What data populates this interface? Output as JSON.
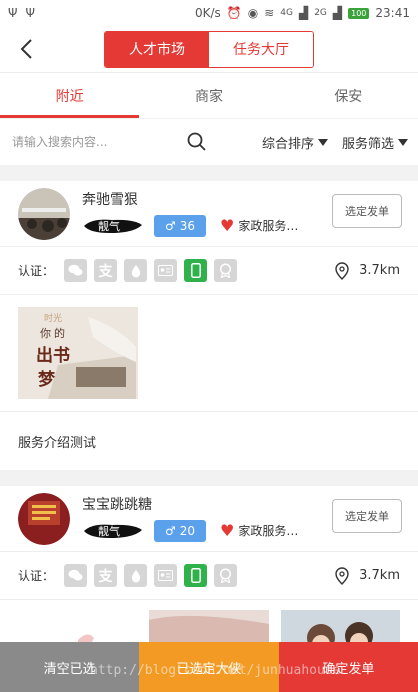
{
  "statusbar": {
    "speed": "0K/s",
    "time": "23:41",
    "battery": "100",
    "net1": "4G",
    "net2": "2G"
  },
  "header": {
    "segments": [
      "人才市场",
      "任务大厅"
    ]
  },
  "tabs": [
    "附近",
    "商家",
    "保安"
  ],
  "filter": {
    "search_placeholder": "请输入搜索内容...",
    "sort_label": "综合排序",
    "service_filter_label": "服务筛选"
  },
  "cards": [
    {
      "name": "奔驰雪狠",
      "tag": "靓气",
      "age": "36",
      "service": "家政服务…",
      "select_label": "选定发单",
      "cert_label": "认证：",
      "distance": "3.7km",
      "photo_text": [
        "你",
        "的",
        "出书",
        "梦"
      ],
      "photo_caption": "时光",
      "description": "服务介绍测试"
    },
    {
      "name": "宝宝跳跳糖",
      "tag": "靓气",
      "age": "20",
      "service": "家政服务…",
      "select_label": "选定发单",
      "cert_label": "认证：",
      "distance": "3.7km"
    }
  ],
  "bottom": {
    "clear": "清空已选",
    "selected": "已选定大侠",
    "confirm": "确定发单"
  },
  "watermark": "http://blog.csdn.net/junhuahouse",
  "colors": {
    "accent": "#e53935",
    "gender_blue": "#5aa0ea",
    "orange": "#f29a23",
    "grey": "#8a8a8a",
    "cert_green": "#2fb24a"
  }
}
